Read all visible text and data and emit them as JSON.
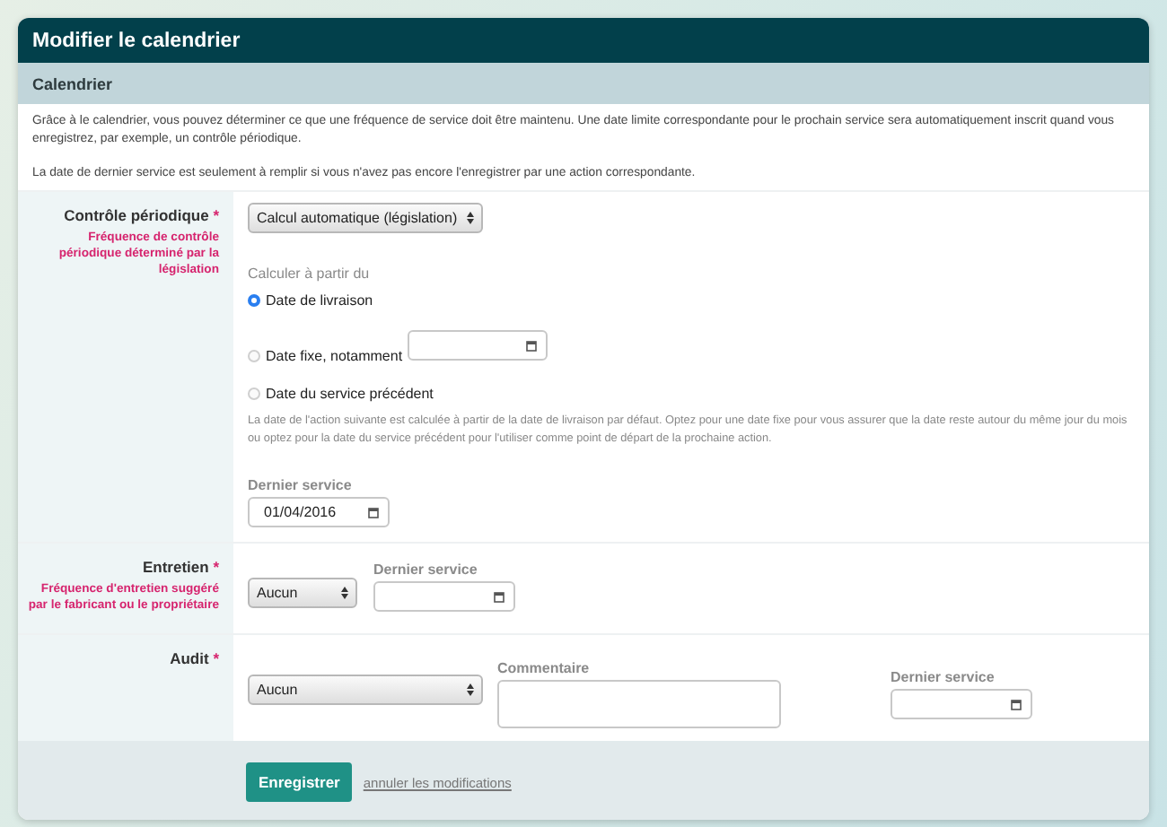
{
  "window": {
    "title": "Modifier le calendrier"
  },
  "section": {
    "title": "Calendrier"
  },
  "intro": [
    "Grâce à le calendrier, vous pouvez déterminer ce que une fréquence de service doit être maintenu. Une date limite correspondante pour le prochain service sera automatiquement inscrit quand vous enregistrez, par exemple, un contrôle périodique.",
    "La date de dernier service est seulement à remplir si vous n'avez pas encore l'enregistrer par une action correspondante."
  ],
  "rows": [
    {
      "kind": "periodic",
      "label": "Contrôle périodique",
      "required_mark": "*",
      "hint": "Fréquence de contrôle périodique déterminé par la législation",
      "select": {
        "value": "Calcul automatique (législation)"
      },
      "calc_label": "Calculer à partir du",
      "options": [
        {
          "kind": "plain",
          "label": "Date de livraison",
          "selected": true
        },
        {
          "kind": "date",
          "label": "Date fixe, notamment",
          "selected": false
        },
        {
          "kind": "plain",
          "label": "Date du service précédent",
          "selected": false
        }
      ],
      "note": "La date de l'action suivante est calculée à partir de la date de livraison par défaut. Optez pour une date fixe pour vous assurer que la date reste autour du même jour du mois ou optez pour la date du service précédent pour l'utiliser comme point de départ de la prochaine action.",
      "last_service": {
        "label": "Dernier service",
        "value": "01/04/2016"
      }
    },
    {
      "kind": "maintenance",
      "label": "Entretien",
      "required_mark": "*",
      "hint": "Fréquence d'entretien suggéré par le fabricant ou le propriétaire",
      "select": {
        "value": "Aucun"
      },
      "last_service": {
        "label": "Dernier service"
      }
    },
    {
      "kind": "audit",
      "label": "Audit",
      "required_mark": "*",
      "select": {
        "value": "Aucun"
      },
      "comment": {
        "label": "Commentaire"
      },
      "last_service": {
        "label": "Dernier service"
      }
    }
  ],
  "actions": {
    "save": "Enregistrer",
    "cancel": "annuler les modifications"
  }
}
